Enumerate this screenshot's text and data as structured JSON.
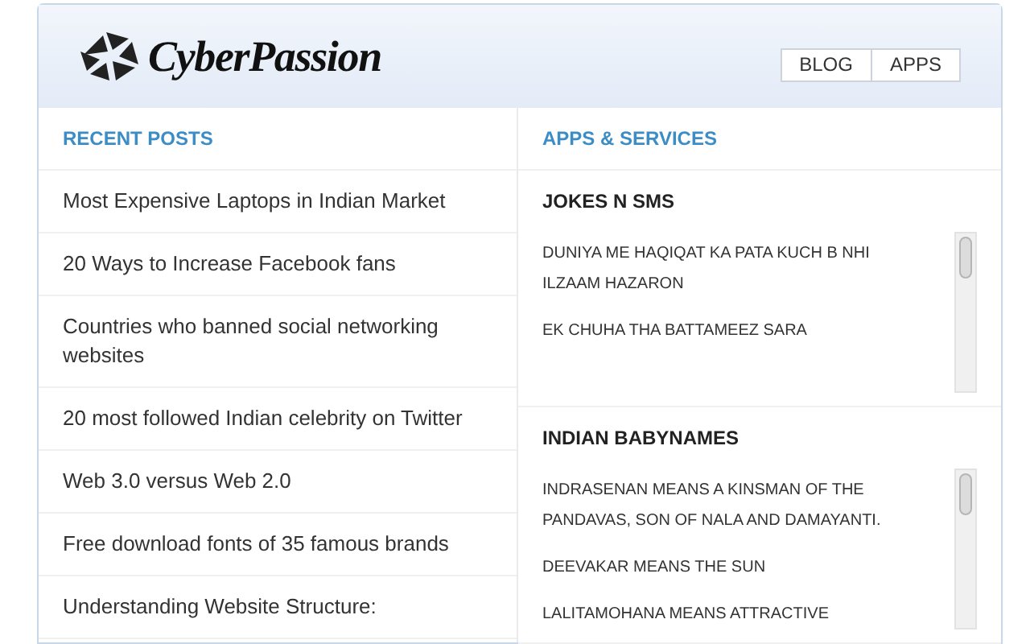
{
  "header": {
    "logo_text": "CyberPassion",
    "nav": [
      {
        "label": "BLOG"
      },
      {
        "label": "APPS"
      }
    ]
  },
  "recent_posts": {
    "title": "RECENT POSTS",
    "items": [
      "Most Expensive Laptops in Indian Market",
      "20 Ways to Increase Facebook fans",
      "Countries who banned social networking websites",
      "20 most followed Indian celebrity on Twitter",
      "Web 3.0 versus Web 2.0",
      "Free download fonts of 35 famous brands",
      "Understanding Website Structure:"
    ]
  },
  "apps_services": {
    "title": "APPS & SERVICES",
    "sections": [
      {
        "title": "JOKES N SMS",
        "entries": [
          "DUNIYA ME HAQIQAT KA PATA KUCH B NHI ILZAAM HAZARON",
          "EK CHUHA THA BATTAMEEZ SARA"
        ]
      },
      {
        "title": "INDIAN BABYNAMES",
        "entries": [
          "INDRASENAN MEANS A KINSMAN OF THE PANDAVAS, SON OF NALA AND DAMAYANTI.",
          "DEEVAKAR MEANS THE SUN",
          "LALITAMOHANA MEANS ATTRACTIVE"
        ]
      }
    ]
  }
}
